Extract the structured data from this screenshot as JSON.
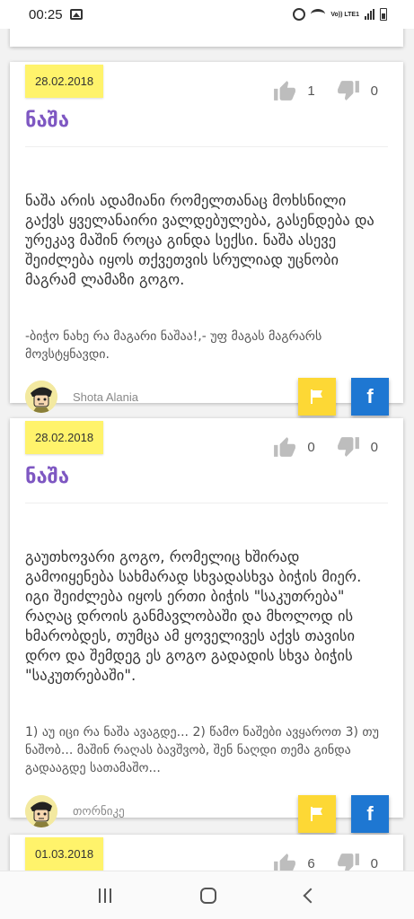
{
  "status_bar": {
    "time": "00:25",
    "network_label": "Vo)) LTE1"
  },
  "entries": [
    {
      "date": "28.02.2018",
      "word": "ნაშა",
      "likes": "1",
      "dislikes": "0",
      "definition": "ნაშა არის ადამიანი რომელთანაც მოხსნილი გაქვს ყველანაირი ვალდებულება, გასენდება და ურეკავ მაშინ როცა გინდა სექსი. ნაშა ასევე შეიძლება იყოს თქვეთვის სრულიად უცნობი მაგრამ ლამაზი გოგო.",
      "example": "-ბიჭო ნახე რა მაგარი ნაშაა!,- უფ მაგას მაგრარს მოვსტყნავდი.",
      "author": "Shota Alania"
    },
    {
      "date": "28.02.2018",
      "word": "ნაშა",
      "likes": "0",
      "dislikes": "0",
      "definition": "გაუთხოვარი გოგო, რომელიც ხშირად გამოიყენება სახმარად სხვადასხვა ბიჭის მიერ. იგი შეიძლება იყოს ერთი ბიჭის \"საკუთრება\" რაღაც დროის განმავლობაში და მხოლოდ ის ხმარობდეს, თუმცა ამ ყოველივეს აქვს თავისი დრო და შემდეგ ეს გოგო გადადის სხვა ბიჭის \"საკუთრებაში\".",
      "example": "1) აუ იცი რა ნაშა ავაგდე... 2) წამო ნაშები ავყაროთ 3) თუ ნაშობ... მაშინ რაღას ბავშვობ, შენ ნაღდი თემა გინდა გადააგდე სათამაშო...",
      "author": "თორნიკე"
    },
    {
      "date": "01.03.2018",
      "likes": "6",
      "dislikes": "0"
    }
  ],
  "colors": {
    "accent": "#7e57c2",
    "date_badge": "#fff36b",
    "flag_button": "#fdd835",
    "facebook_button": "#1e77d2"
  },
  "icons": {
    "like": "thumbs-up-icon",
    "dislike": "thumbs-down-icon",
    "report": "flag-icon",
    "share": "facebook-icon"
  },
  "share_label": "f"
}
